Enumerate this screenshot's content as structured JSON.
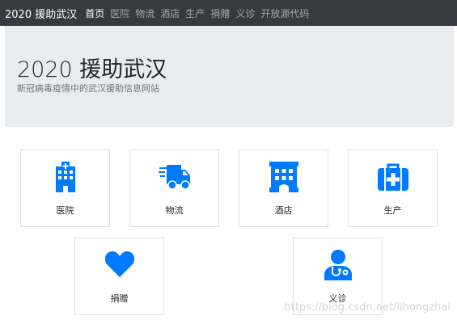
{
  "navbar": {
    "brand": "2020 援助武汉",
    "items": [
      {
        "label": "首页",
        "active": true
      },
      {
        "label": "医院",
        "active": false
      },
      {
        "label": "物流",
        "active": false
      },
      {
        "label": "酒店",
        "active": false
      },
      {
        "label": "生产",
        "active": false
      },
      {
        "label": "捐赠",
        "active": false
      },
      {
        "label": "义诊",
        "active": false
      },
      {
        "label": "开放源代码",
        "active": false
      }
    ]
  },
  "jumbotron": {
    "title": "2020 援助武汉",
    "lead": "新冠病毒疫情中的武汉援助信息网站"
  },
  "cards": [
    {
      "label": "医院",
      "icon": "hospital-icon"
    },
    {
      "label": "物流",
      "icon": "truck-icon"
    },
    {
      "label": "酒店",
      "icon": "hotel-icon"
    },
    {
      "label": "生产",
      "icon": "medkit-icon"
    },
    {
      "label": "捐赠",
      "icon": "heart-icon"
    },
    {
      "label": "义诊",
      "icon": "doctor-icon"
    }
  ],
  "colors": {
    "accent": "#007bff",
    "navbar_bg": "#343a40",
    "jumbotron_bg": "#e9ecef"
  },
  "watermark": "https://blog.csdn.net/lihongzhai"
}
